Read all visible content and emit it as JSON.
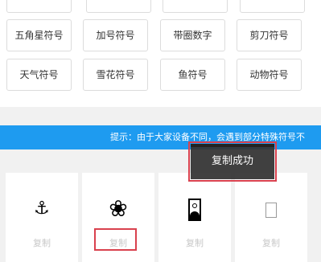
{
  "categories": [
    {
      "label": ""
    },
    {
      "label": ""
    },
    {
      "label": ""
    },
    {
      "label": ""
    },
    {
      "label": "五角星符号"
    },
    {
      "label": "加号符号"
    },
    {
      "label": "带圈数字"
    },
    {
      "label": "剪刀符号"
    },
    {
      "label": "天气符号"
    },
    {
      "label": "雪花符号"
    },
    {
      "label": "鱼符号"
    },
    {
      "label": "动物符号"
    }
  ],
  "notice": {
    "text": "提示：由于大家设备不同，会遇到部分特殊符号不"
  },
  "toast": {
    "message": "复制成功"
  },
  "symbols": [
    {
      "glyph": "⚓",
      "icon": "anchor-icon",
      "copy_label": "复制"
    },
    {
      "glyph": "❀",
      "icon": "flower-icon",
      "copy_label": "复制"
    },
    {
      "glyph": "",
      "icon": "portrait-icon",
      "copy_label": "复制"
    },
    {
      "glyph": "",
      "icon": "empty-box-icon",
      "copy_label": "复制"
    }
  ],
  "colors": {
    "notice_bar": "#1e9bf0",
    "highlight": "#d9414e",
    "toast_bg": "#333333"
  }
}
